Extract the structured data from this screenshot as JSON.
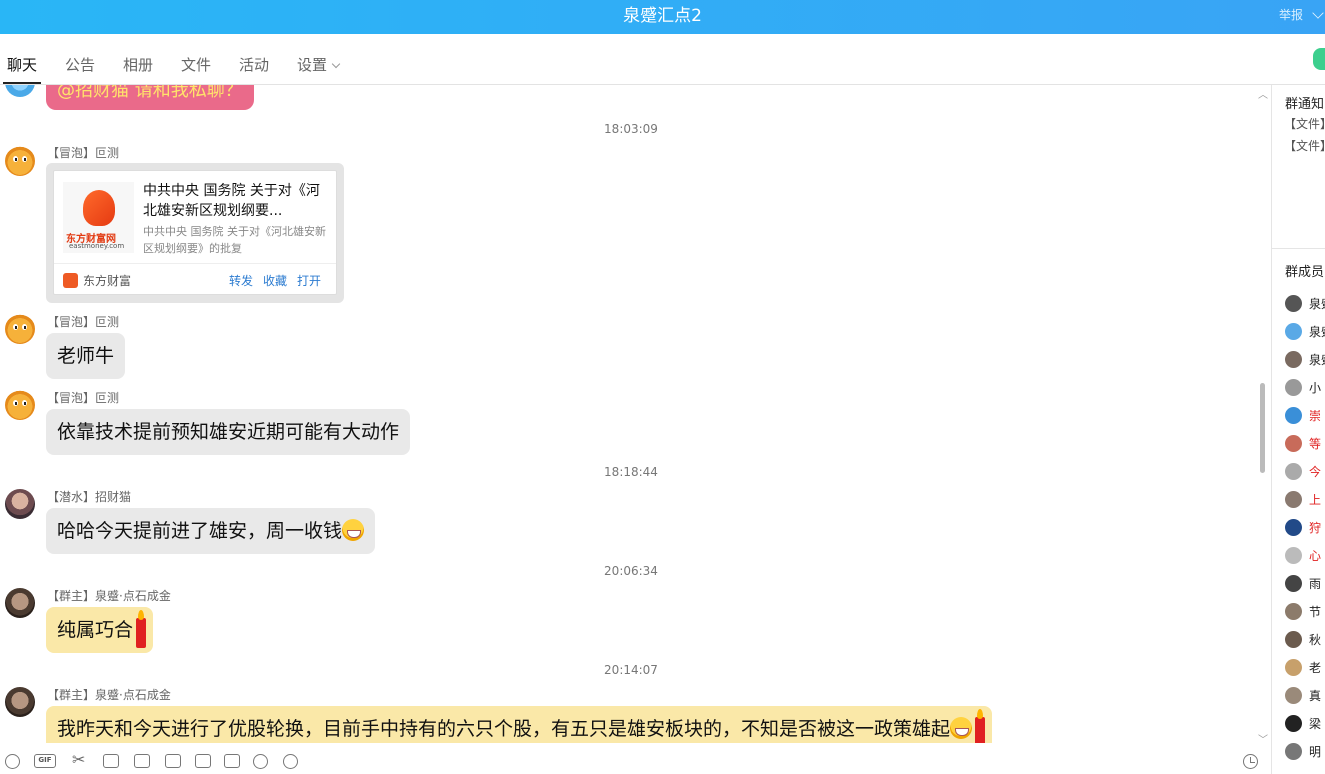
{
  "window": {
    "title": "泉蹙汇点2",
    "report_label": "举报"
  },
  "tabs": [
    {
      "label": "聊天",
      "active": true
    },
    {
      "label": "公告"
    },
    {
      "label": "相册"
    },
    {
      "label": "文件"
    },
    {
      "label": "活动"
    },
    {
      "label": "设置"
    }
  ],
  "chat": {
    "partial_top_bubble": "@招财猫  请和我私聊？",
    "times": [
      "18:03:09",
      "18:18:44",
      "20:06:34",
      "20:14:07"
    ],
    "messages": [
      {
        "sender": "【冒泡】叵测",
        "card": {
          "title": "中共中央 国务院 关于对《河北雄安新区规划纲要...",
          "desc": "中共中央 国务院 关于对《河北雄安新区规划纲要》的批复",
          "logo_cn": "东方财富网",
          "logo_en": "eastmoney.com",
          "source": "东方财富",
          "actions": [
            "转发",
            "收藏",
            "打开"
          ]
        }
      },
      {
        "sender": "【冒泡】叵测",
        "text": "老师牛"
      },
      {
        "sender": "【冒泡】叵测",
        "text": "依靠技术提前预知雄安近期可能有大动作"
      },
      {
        "sender": "【潜水】招财猫",
        "text": "哈哈今天提前进了雄安，周一收钱",
        "emoji": "grinning-face"
      },
      {
        "sender": "【群主】泉蹙·点石成金",
        "text": "纯属巧合",
        "emoji": "candle"
      },
      {
        "sender": "【群主】泉蹙·点石成金",
        "text": "我昨天和今天进行了优股轮换，目前手中持有的六只个股，有五只是雄安板块的，不知是否被这一政策雄起",
        "emoji": "grinning-face, candle"
      }
    ]
  },
  "sidebar": {
    "notice_title": "群通知",
    "files": [
      "【文件】",
      "【文件】"
    ],
    "members_title": "群成员",
    "members": [
      {
        "name": "泉蹙",
        "color": "#222222"
      },
      {
        "name": "泉蹙",
        "color": "#222222"
      },
      {
        "name": "泉蹙",
        "color": "#222222"
      },
      {
        "name": "小",
        "color": "#222222"
      },
      {
        "name": "崇",
        "color": "#e02020"
      },
      {
        "name": "等",
        "color": "#e02020"
      },
      {
        "name": "今",
        "color": "#e02020"
      },
      {
        "name": "上",
        "color": "#e02020"
      },
      {
        "name": "狩",
        "color": "#e02020"
      },
      {
        "name": "心",
        "color": "#e02020"
      },
      {
        "name": "雨",
        "color": "#222222"
      },
      {
        "name": "节",
        "color": "#222222"
      },
      {
        "name": "秋",
        "color": "#222222"
      },
      {
        "name": "老",
        "color": "#222222"
      },
      {
        "name": "真",
        "color": "#222222"
      },
      {
        "name": "梁",
        "color": "#222222"
      },
      {
        "name": "明",
        "color": "#222222"
      }
    ]
  },
  "toolbar": {
    "icons": [
      "emoji-icon",
      "gif-icon",
      "scissors-icon",
      "folder-icon",
      "image-icon",
      "shop-icon",
      "gift-icon",
      "calendar-icon",
      "bell-icon",
      "more-icon"
    ],
    "gif_label": "GIF"
  },
  "colors": {
    "titlebar": "#29b6f6",
    "link": "#2b7bd0",
    "highlight_bubble": "#fae8a8"
  }
}
